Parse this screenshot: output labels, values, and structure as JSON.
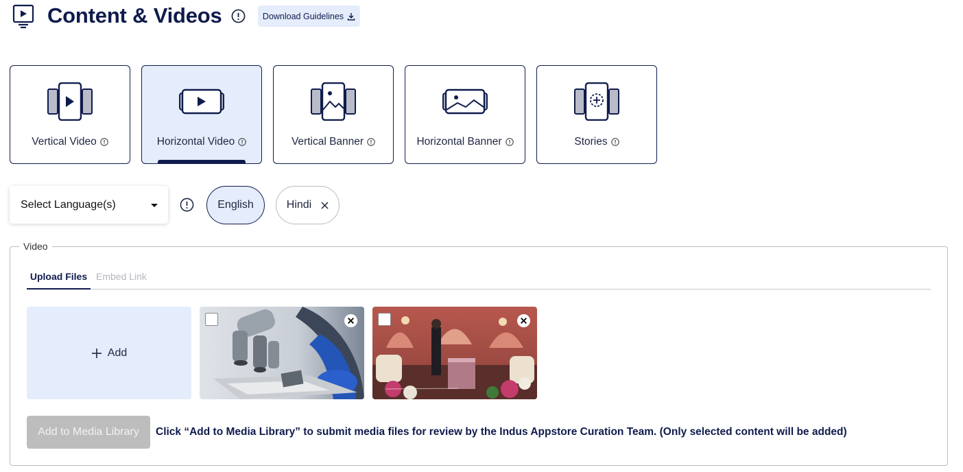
{
  "header": {
    "title": "Content & Videos",
    "download_label": "Download Guidelines"
  },
  "content_types": [
    {
      "label": "Vertical Video",
      "icon": "vertical-video-icon",
      "selected": false
    },
    {
      "label": "Horizontal Video",
      "icon": "horizontal-video-icon",
      "selected": true
    },
    {
      "label": "Vertical Banner",
      "icon": "vertical-banner-icon",
      "selected": false
    },
    {
      "label": "Horizontal Banner",
      "icon": "horizontal-banner-icon",
      "selected": false
    },
    {
      "label": "Stories",
      "icon": "stories-icon",
      "selected": false
    }
  ],
  "language": {
    "select_label": "Select Language(s)",
    "chips": [
      {
        "label": "English",
        "selected": true
      },
      {
        "label": "Hindi",
        "selected": false,
        "removable": true
      }
    ]
  },
  "video_section": {
    "legend": "Video",
    "tabs": [
      {
        "label": "Upload Files",
        "active": true
      },
      {
        "label": "Embed Link",
        "active": false
      }
    ],
    "add_label": "Add",
    "thumbnails": [
      {
        "subject": "microscope",
        "checked": false
      },
      {
        "subject": "palace-scene",
        "checked": false
      }
    ],
    "add_to_library_label": "Add to Media Library",
    "hint_text": "Click “Add to Media Library” to submit media files for review by the Indus Appstore Curation Team. (Only selected content will be added)"
  },
  "colors": {
    "navy": "#0f1b4c",
    "selected_bg": "#e5ecfb",
    "disabled_button": "#bdbdbd"
  }
}
